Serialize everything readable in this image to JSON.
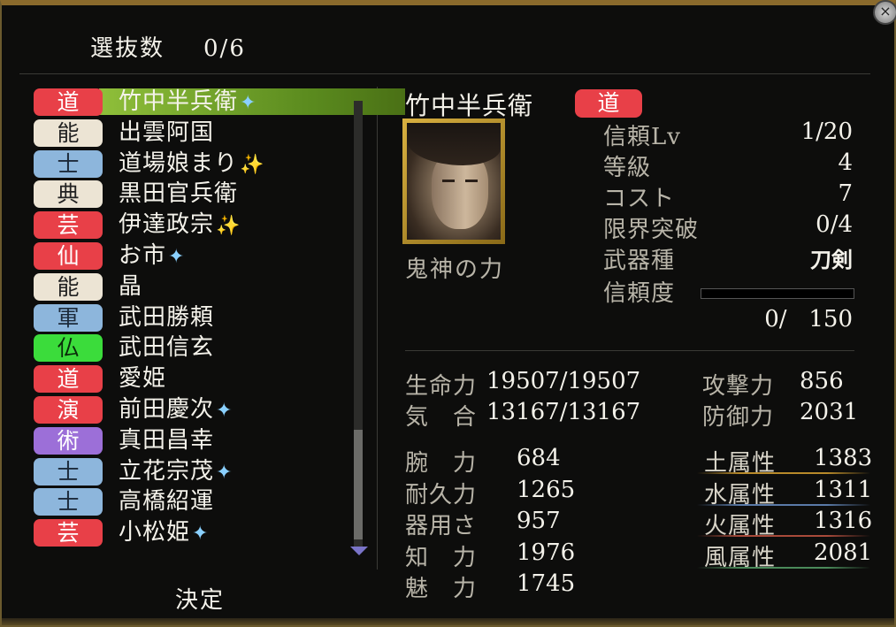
{
  "header": {
    "selected_label": "選抜数",
    "selected_count": "0/6"
  },
  "close_icon": "×",
  "roster": [
    {
      "tag": "道",
      "tag_color": "red",
      "name": "竹中半兵衛",
      "star": "✦",
      "star_color": "blue",
      "selected": true
    },
    {
      "tag": "能",
      "tag_color": "cream",
      "name": "出雲阿国",
      "star": "",
      "star_color": ""
    },
    {
      "tag": "士",
      "tag_color": "blue",
      "name": "道場娘まり",
      "star": "✨",
      "star_color": "gold"
    },
    {
      "tag": "典",
      "tag_color": "cream",
      "name": "黒田官兵衛",
      "star": "",
      "star_color": ""
    },
    {
      "tag": "芸",
      "tag_color": "red",
      "name": "伊達政宗",
      "star": "✨",
      "star_color": "gold"
    },
    {
      "tag": "仙",
      "tag_color": "red",
      "name": "お市",
      "star": "✦",
      "star_color": "blue"
    },
    {
      "tag": "能",
      "tag_color": "cream",
      "name": "晶",
      "star": "",
      "star_color": ""
    },
    {
      "tag": "軍",
      "tag_color": "blue",
      "name": "武田勝頼",
      "star": "",
      "star_color": ""
    },
    {
      "tag": "仏",
      "tag_color": "green",
      "name": "武田信玄",
      "star": "",
      "star_color": ""
    },
    {
      "tag": "道",
      "tag_color": "red",
      "name": "愛姫",
      "star": "",
      "star_color": ""
    },
    {
      "tag": "演",
      "tag_color": "red",
      "name": "前田慶次",
      "star": "✦",
      "star_color": "blue"
    },
    {
      "tag": "術",
      "tag_color": "purple",
      "name": "真田昌幸",
      "star": "",
      "star_color": ""
    },
    {
      "tag": "士",
      "tag_color": "blue",
      "name": "立花宗茂",
      "star": "✦",
      "star_color": "blue"
    },
    {
      "tag": "士",
      "tag_color": "blue",
      "name": "高橋紹運",
      "star": "",
      "star_color": ""
    },
    {
      "tag": "芸",
      "tag_color": "red",
      "name": "小松姫",
      "star": "✦",
      "star_color": "blue"
    }
  ],
  "decide_button": "決定",
  "detail": {
    "name": "竹中半兵衛",
    "tag": "道",
    "skill": "鬼神の力",
    "info": [
      {
        "label": "信頼Lv",
        "value": "1/20"
      },
      {
        "label": "等級",
        "value": "4"
      },
      {
        "label": "コスト",
        "value": "7"
      },
      {
        "label": "限界突破",
        "value": "0/4"
      },
      {
        "label": "武器種",
        "value": "刀剣"
      },
      {
        "label": "信頼度",
        "value": ""
      }
    ],
    "trust_progress": 0,
    "trust_text": "0/   150",
    "life_label": "生命力",
    "life_value": "19507/19507",
    "spirit_label": "気　合",
    "spirit_value": "13167/13167",
    "attack_label": "攻撃力",
    "attack_value": "856",
    "defense_label": "防御力",
    "defense_value": "2031",
    "stats": [
      {
        "label": "腕　力",
        "value": "684"
      },
      {
        "label": "耐久力",
        "value": "1265"
      },
      {
        "label": "器用さ",
        "value": "957"
      },
      {
        "label": "知　力",
        "value": "1976"
      },
      {
        "label": "魅　力",
        "value": "1745"
      }
    ],
    "elements": [
      {
        "label": "土属性",
        "value": "1383",
        "color": "#b88a2a"
      },
      {
        "label": "水属性",
        "value": "1311",
        "color": "#5a7aa8"
      },
      {
        "label": "火属性",
        "value": "1316",
        "color": "#a84a3a"
      },
      {
        "label": "風属性",
        "value": "2081",
        "color": "#4a8a5a"
      }
    ]
  }
}
